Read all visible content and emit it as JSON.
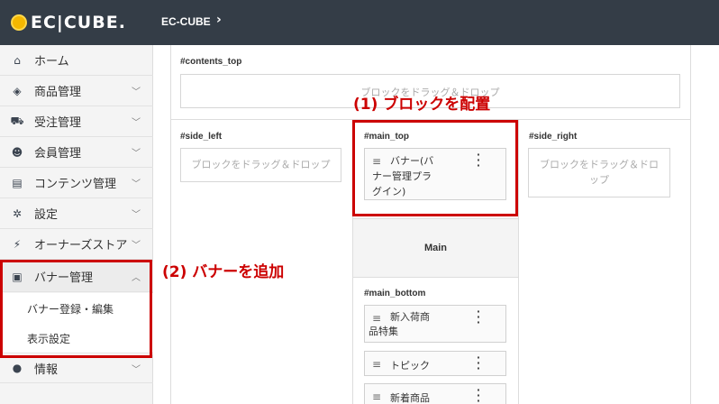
{
  "header": {
    "logo_text": "EC|CUBE.",
    "title": "EC-CUBE",
    "chevron": "›"
  },
  "sidebar": {
    "items": [
      {
        "label": "ホーム",
        "icon": "home-icon",
        "glyph": "⌂",
        "chevron": ""
      },
      {
        "label": "商品管理",
        "icon": "box-icon",
        "glyph": "◈",
        "chevron": "﹀"
      },
      {
        "label": "受注管理",
        "icon": "cart-icon",
        "glyph": "⛟",
        "chevron": "﹀"
      },
      {
        "label": "会員管理",
        "icon": "users-icon",
        "glyph": "☻",
        "chevron": "﹀"
      },
      {
        "label": "コンテンツ管理",
        "icon": "file-icon",
        "glyph": "▤",
        "chevron": "﹀"
      },
      {
        "label": "設定",
        "icon": "gear-icon",
        "glyph": "✲",
        "chevron": "﹀"
      },
      {
        "label": "オーナーズストア",
        "icon": "plug-icon",
        "glyph": "⚡",
        "chevron": "﹀"
      },
      {
        "label": "バナー管理",
        "icon": "image-icon",
        "glyph": "▣",
        "chevron": "︿"
      },
      {
        "label": "情報",
        "icon": "info-icon",
        "glyph": "●",
        "chevron": "﹀"
      }
    ],
    "sub_items": [
      "バナー登録・編集",
      "表示設定"
    ]
  },
  "layout": {
    "contents_top": {
      "label": "#contents_top",
      "drop_text": "ブロックをドラッグ＆ドロップ"
    },
    "side_left": {
      "label": "#side_left",
      "drop_text": "ブロックをドラッグ＆ドロップ"
    },
    "main_top": {
      "label": "#main_top",
      "block_line1": "バナー(バ",
      "block_line2": "ナー管理プラ",
      "block_line3": "グイン)"
    },
    "side_right": {
      "label": "#side_right",
      "drop_text_line1": "ブロックをドラッグ＆ドロ",
      "drop_text_line2": "ップ"
    },
    "main": {
      "label": "Main"
    },
    "main_bottom": {
      "label": "#main_bottom",
      "blocks": [
        {
          "line1": "新入荷商",
          "line2": "品特集"
        },
        {
          "line1": "トピック"
        },
        {
          "line1": "新着商品"
        }
      ]
    }
  },
  "annotations": {
    "step1": "(1) ブロックを配置",
    "step2": "(2) バナーを追加",
    "color": "#cc0000"
  }
}
